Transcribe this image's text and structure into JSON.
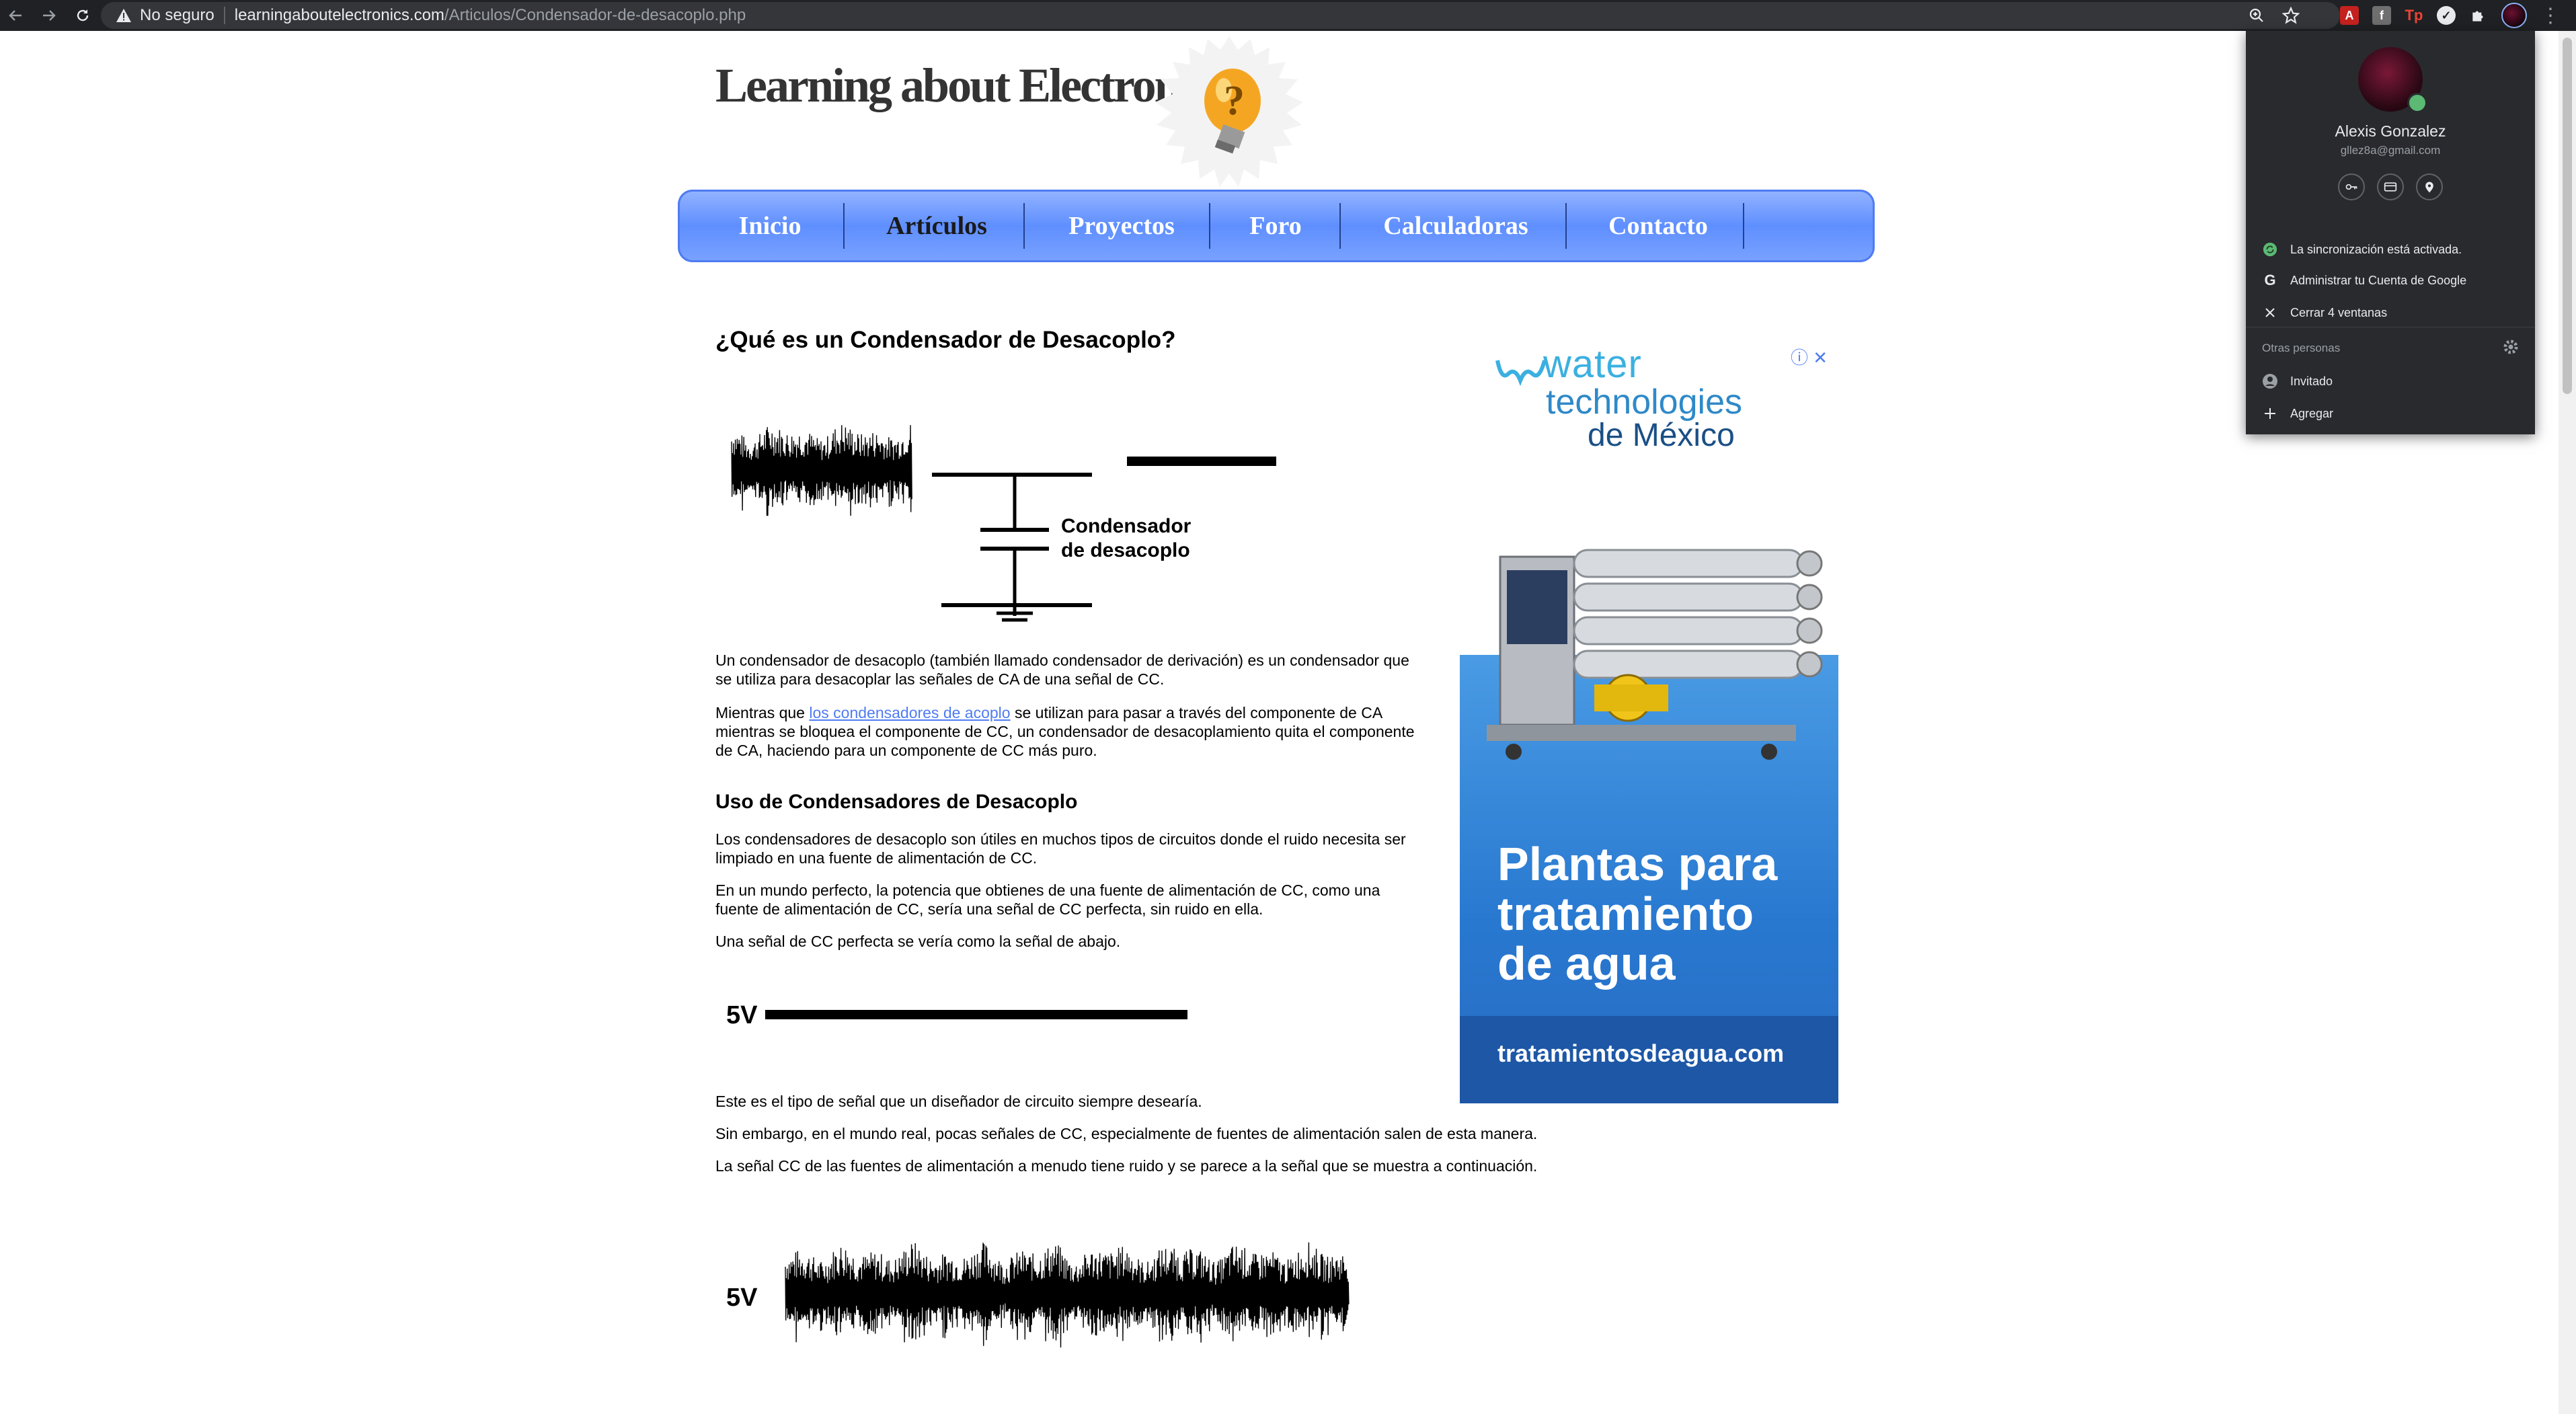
{
  "browser": {
    "security_label": "No seguro",
    "url_host": "learningaboutelectronics.com",
    "url_path": "/Articulos/Condensador-de-desacoplo.php",
    "icons": [
      "back-icon",
      "forward-icon",
      "reload-icon",
      "warning-icon",
      "zoom-icon",
      "star-icon",
      "pdf-extension-icon",
      "facebook-extension-icon",
      "tp-extension-icon",
      "circle-extension-icon",
      "puzzle-icon",
      "profile-icon",
      "menu-icon"
    ]
  },
  "site": {
    "title": "Learning about Electronics"
  },
  "nav": {
    "items": [
      "Inicio",
      "Artículos",
      "Proyectos",
      "Foro",
      "Calculadoras",
      "Contacto"
    ],
    "active": "Artículos"
  },
  "article": {
    "heading": "¿Qué es un Condensador de Desacoplo?",
    "diagram_label_line1": "Condensador",
    "diagram_label_line2": "de desacoplo",
    "p1": "Un condensador de desacoplo (también llamado condensador de derivación) es un condensador que se utiliza para desacoplar las señales de CA de una señal de CC.",
    "p2_before": "Mientras que ",
    "p2_link": "los condensadores de acoplo",
    "p2_after": " se utilizan para pasar a través del componente de CA mientras se bloquea el componente de CC, un condensador de desacoplamiento quita el componente de CA, haciendo para un componente de CC más puro.",
    "subheading": "Uso de Condensadores de Desacoplo",
    "p3": "Los condensadores de desacoplo son útiles en muchos tipos de circuitos donde el ruido necesita ser limpiado en una fuente de alimentación de CC.",
    "p4": "En un mundo perfecto, la potencia que obtienes de una fuente de alimentación de CC, como una fuente de alimentación de CC, sería una señal de CC perfecta, sin ruido en ella.",
    "p5": "Una señal de CC perfecta se vería como la señal de abajo.",
    "signal_label_clean": "5V",
    "p6": "Este es el tipo de señal que un diseñador de circuito siempre desearía.",
    "p7": "Sin embargo, en el mundo real, pocas señales de CC, especialmente de fuentes de alimentación salen de esta manera.",
    "p8": "La señal CC de las fuentes de alimentación a menudo tiene ruido y se parece a la señal que se muestra a continuación.",
    "signal_label_noisy": "5V"
  },
  "ad": {
    "brand_word1": "water",
    "brand_word2": "technologies",
    "brand_word3": "de México",
    "headline": "Plantas para tratamiento de agua",
    "url": "tratamientosdeagua.com",
    "close_symbol": "ⓘ ✕"
  },
  "profile_menu": {
    "name": "Alexis Gonzalez",
    "email": "gllez8a@gmail.com",
    "quick_icons": [
      "key-icon",
      "card-icon",
      "location-icon"
    ],
    "sync_label": "La sincronización está activada.",
    "manage_account_label": "Administrar tu Cuenta de Google",
    "close_windows_label": "Cerrar 4 ventanas",
    "others_heading": "Otras personas",
    "guest_label": "Invitado",
    "add_label": "Agregar"
  }
}
